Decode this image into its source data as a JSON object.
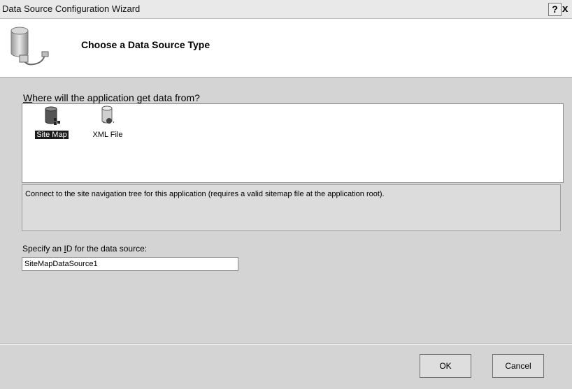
{
  "window": {
    "title": "Data Source Configuration Wizard",
    "help_label": "?",
    "close_label": "x"
  },
  "header": {
    "heading": "Choose a Data Source Type",
    "icon": "database-plug-icon"
  },
  "source_picker": {
    "question_prefix": "W",
    "question_rest": "here will the application get data from?",
    "items": [
      {
        "label": "Site Map",
        "icon": "sitemap-database-icon",
        "selected": true
      },
      {
        "label": "XML File",
        "icon": "xml-database-icon",
        "selected": false
      }
    ],
    "description": "Connect to the site navigation tree for this application (requires a valid sitemap file at the application root)."
  },
  "id_field": {
    "label_prefix": "Specify an ",
    "label_mnemonic": "I",
    "label_suffix": "D for the data source:",
    "value": "SiteMapDataSource1"
  },
  "buttons": {
    "ok": "OK",
    "cancel": "Cancel"
  },
  "colors": {
    "selection": "#1a1a1a",
    "header_bg": "#ffffff",
    "body_bg": "#d4d4d4"
  }
}
